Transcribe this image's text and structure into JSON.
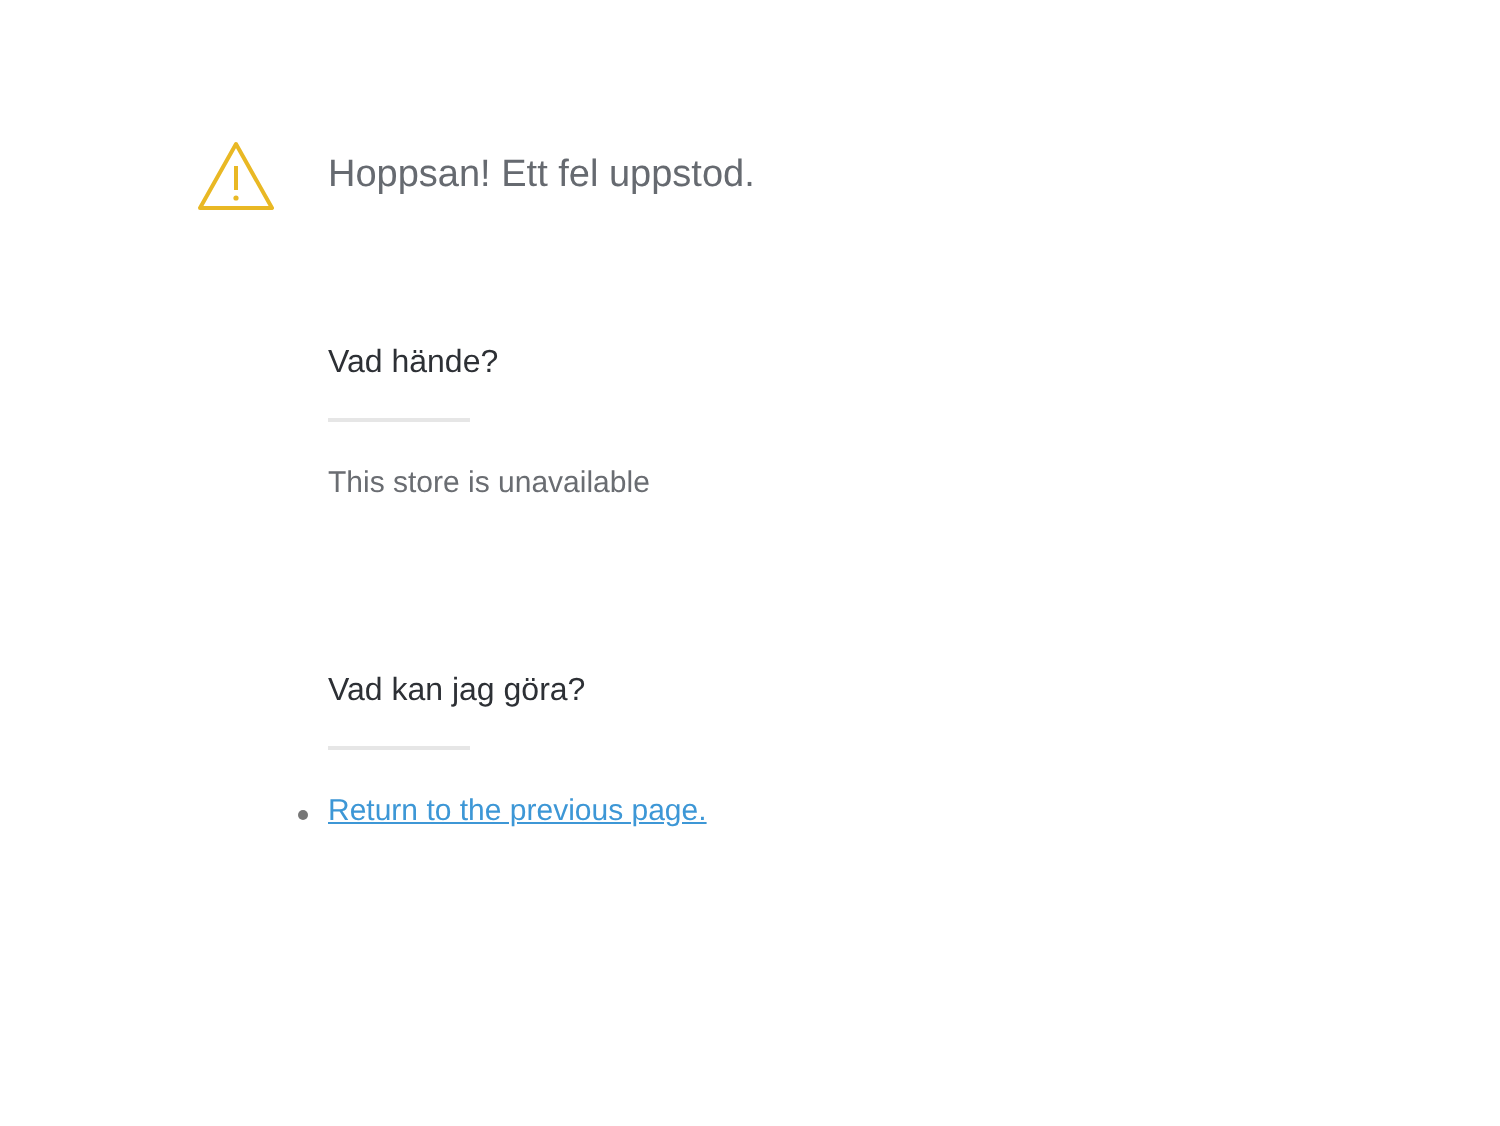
{
  "title": "Hoppsan! Ett fel uppstod.",
  "sections": [
    {
      "heading": "Vad hände?",
      "text": "This store is unavailable"
    },
    {
      "heading": "Vad kan jag göra?",
      "links": [
        "Return to the previous page."
      ]
    }
  ]
}
